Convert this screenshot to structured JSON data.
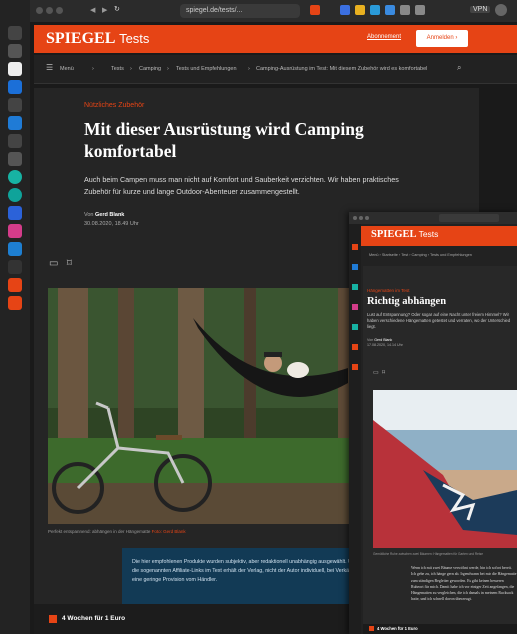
{
  "browser": {
    "url": "spiegel.de/tests/...",
    "tab_label": "VPN"
  },
  "header": {
    "logo_brand": "SPIEGEL",
    "logo_section": "Tests",
    "abo_link": "Abonnement",
    "login_button": "Anmelden",
    "login_arrow": "›"
  },
  "breadcrumb": {
    "menu": "Menü",
    "items": [
      "Tests",
      "Camping",
      "Tests und Empfehlungen",
      "Camping-Ausrüstung im Test: Mit diesem Zubehör wird es komfortabel"
    ],
    "sep": "›"
  },
  "article": {
    "kicker": "Nützliches Zubehör",
    "title": "Mit dieser Ausrüstung wird Camping komfortabel",
    "lead": "Auch beim Campen muss man nicht auf Komfort und Sauberkeit verzichten. Wir haben praktisches Zubehör für kurze und lange Outdoor-Abenteuer zusammengestellt.",
    "author_prefix": "Von",
    "author": "Gerd Blank",
    "date": "30.08.2020, 18.49 Uhr",
    "caption": "Perfekt entspannend: abhängen in der Hängematte",
    "caption_credit": "Foto: Gerd Blank",
    "disclaimer": "Die hier empfohlenen Produkte wurden subjektiv, aber redaktionell unabhängig ausgewählt. Über die sogenannten Affiliate-Links im Text erhält der Verlag, nicht der Autor individuell, bei Verkäufen eine geringe Provision vom Händler."
  },
  "promo": {
    "label": "4 Wochen für 1 Euro"
  },
  "window2": {
    "logo_brand": "SPIEGEL",
    "logo_section": "Tests",
    "breadcrumb": "Menü › Startseite › Test › Camping › Tests und Empfehlungen",
    "kicker": "Hängematten im Test",
    "title": "Richtig abhängen",
    "lead": "Lust auf Entspannung? Oder sogar auf eine Nacht unter freiem Himmel? Wir haben verschiedene Hängematten getestet und verraten, wo der Unterschied liegt.",
    "author_prefix": "Von",
    "author": "Gerd Blank",
    "date": "17.08.2020, 14.14 Uhr",
    "caption": "Gemütliche Ruhe zwischen zwei Bäumen: Hängematten für Garten und Reise",
    "body": "Wenn ich mit zwei Bäume verwöhnt werde, bin ich sofort bereit. Ich gebe zu, ich hänge gern ab. Irgendwann bei mir die Hängematte zum ständigen Begleiter geworden. Es gibt keinen besseren Ruheort für mich. Damit habe ich vor einiger Zeit angefangen, die Hängematten zu vergleichen, die ich damals in meinem Rucksack hatte, und ich schnell davon überzeugt.",
    "promo": "4 Wochen für 1 Euro"
  },
  "colors": {
    "brand": "#e64415",
    "bg": "#1a1a1a",
    "disclaimer_bg": "#123a55"
  }
}
